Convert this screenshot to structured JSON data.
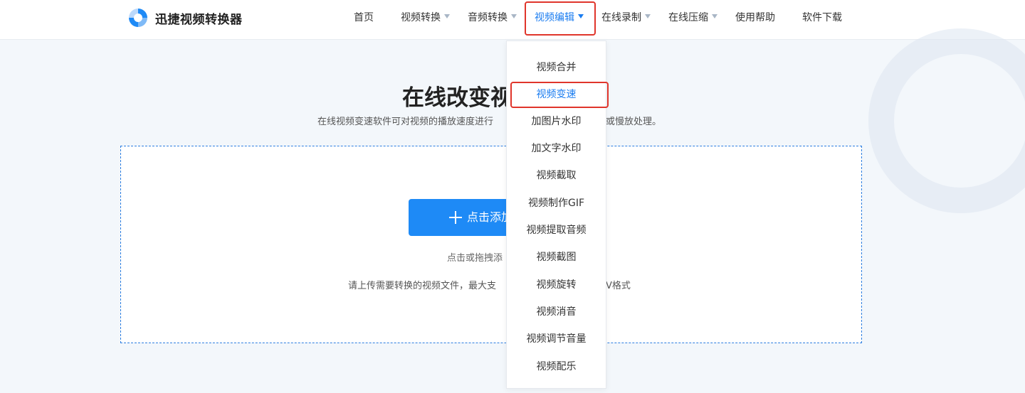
{
  "header": {
    "brand": "迅捷视频转换器",
    "nav": [
      {
        "label": "首页",
        "has_caret": false
      },
      {
        "label": "视频转换",
        "has_caret": true
      },
      {
        "label": "音频转换",
        "has_caret": true
      },
      {
        "label": "视频编辑",
        "has_caret": true,
        "active": true
      },
      {
        "label": "在线录制",
        "has_caret": true
      },
      {
        "label": "在线压缩",
        "has_caret": true
      },
      {
        "label": "使用帮助",
        "has_caret": false
      },
      {
        "label": "软件下载",
        "has_caret": false
      }
    ]
  },
  "main": {
    "title": "在线改变视",
    "subtitle_left": "在线视频变速软件可对视频的播放速度进行",
    "subtitle_right": "或慢放处理。",
    "upload": {
      "button_label": "点击添加",
      "drag_hint": "点击或拖拽添",
      "limit_left": "请上传需要转换的视频文件，最大支",
      "limit_right": "V格式"
    }
  },
  "dropdown": {
    "items": [
      "视频合并",
      "视频变速",
      "加图片水印",
      "加文字水印",
      "视频截取",
      "视频制作GIF",
      "视频提取音频",
      "视频截图",
      "视频旋转",
      "视频消音",
      "视频调节音量",
      "视频配乐"
    ],
    "selected_index": 1
  },
  "colors": {
    "accent": "#1a7cf0",
    "button": "#1e8af6",
    "highlight": "#e0352b",
    "text": "#333333"
  }
}
